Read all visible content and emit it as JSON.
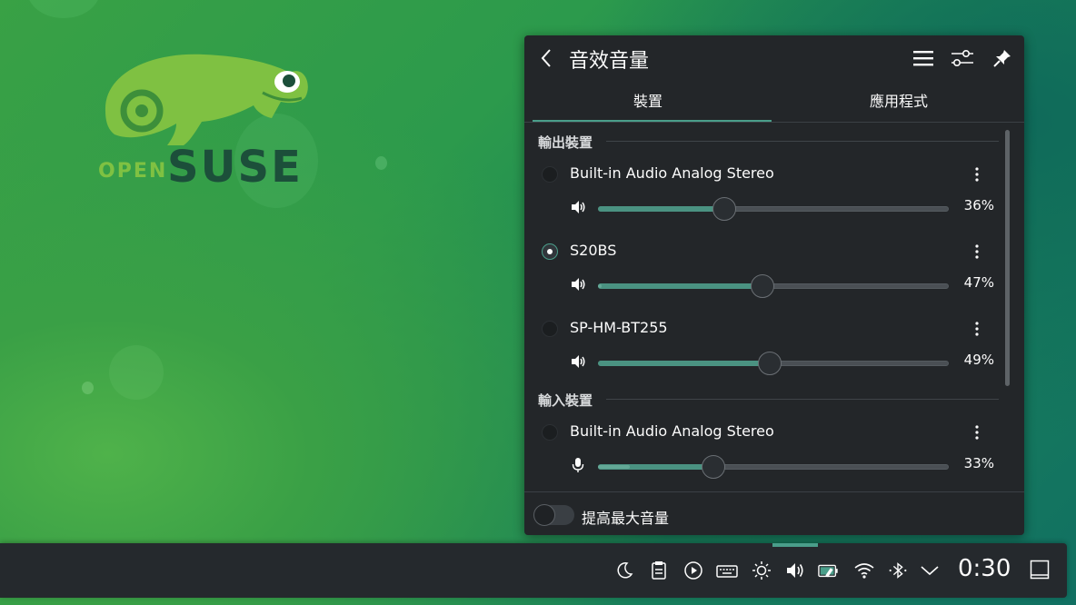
{
  "wallpaper": {
    "logo": {
      "open_text": "OPEN",
      "suse_text": "SUSE",
      "icon": "chameleon-logo"
    }
  },
  "panel": {
    "title": "音效音量",
    "icons": {
      "back": "chevron-left-icon",
      "menu": "hamburger-menu-icon",
      "configure": "sliders-icon",
      "pin": "pin-icon"
    },
    "tabs": [
      {
        "label": "裝置",
        "active": true
      },
      {
        "label": "應用程式",
        "active": false
      }
    ],
    "sections": [
      {
        "title": "輸出裝置",
        "devices": [
          {
            "name": "Built-in Audio Analog Stereo",
            "selected": false,
            "volume": 36,
            "level": 0,
            "percent_label": "36%",
            "icon": "speaker-icon"
          },
          {
            "name": "S20BS",
            "selected": true,
            "volume": 47,
            "level": 1,
            "percent_label": "47%",
            "icon": "speaker-icon"
          },
          {
            "name": "SP-HM-BT255",
            "selected": false,
            "volume": 49,
            "level": 0,
            "percent_label": "49%",
            "icon": "speaker-icon"
          }
        ]
      },
      {
        "title": "輸入裝置",
        "devices": [
          {
            "name": "Built-in Audio Analog Stereo",
            "selected": false,
            "volume": 33,
            "level": 9,
            "percent_label": "33%",
            "icon": "microphone-icon"
          }
        ]
      }
    ],
    "footer": {
      "label": "提高最大音量",
      "toggle_on": false
    }
  },
  "taskbar": {
    "tray_icons": [
      "night-mode-icon",
      "clipboard-icon",
      "media-player-icon",
      "keyboard-icon",
      "brightness-icon",
      "volume-icon",
      "battery-icon",
      "wifi-icon",
      "bluetooth-icon",
      "expand-tray-icon"
    ],
    "clock": "0:30",
    "show_desktop_icon": "show-desktop-icon"
  },
  "colors": {
    "accent": "#4a9e8a",
    "panel_bg": "#232629",
    "taskbar_bg": "#25292d"
  }
}
